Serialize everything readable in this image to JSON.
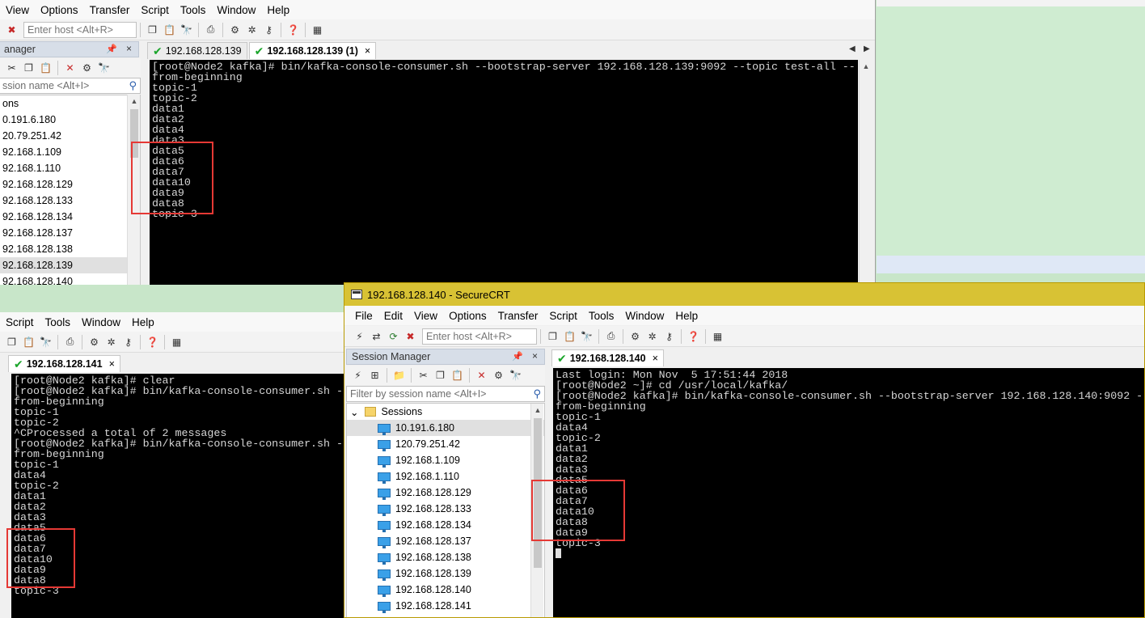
{
  "win_a": {
    "menu": [
      "View",
      "Options",
      "Transfer",
      "Script",
      "Tools",
      "Window",
      "Help"
    ],
    "host_placeholder": "Enter host <Alt+R>",
    "sm_title": "anager",
    "filter_placeholder": "ssion name <Alt+I>",
    "tree_header": "ons",
    "sessions": [
      "0.191.6.180",
      "20.79.251.42",
      "92.168.1.109",
      "92.168.1.110",
      "92.168.128.129",
      "92.168.128.133",
      "92.168.128.134",
      "92.168.128.137",
      "92.168.128.138",
      "92.168.128.139",
      "92.168.128.140"
    ],
    "selected_session": "92.168.128.139",
    "tabs": [
      {
        "label": "192.168.128.139",
        "active": false
      },
      {
        "label": "192.168.128.139 (1)",
        "active": true,
        "close": "×"
      }
    ],
    "terminal": [
      "[root@Node2 kafka]# bin/kafka-console-consumer.sh --bootstrap-server 192.168.128.139:9092 --topic test-all --",
      "from-beginning",
      "topic-1",
      "topic-2",
      "data1",
      "data2",
      "data4",
      "data3",
      "data5",
      "data6",
      "data7",
      "data10",
      "data9",
      "data8",
      "topic-3"
    ]
  },
  "win_b": {
    "menu": [
      "Script",
      "Tools",
      "Window",
      "Help"
    ],
    "tabs": [
      {
        "label": "192.168.128.141",
        "active": true,
        "close": "×"
      }
    ],
    "terminal": [
      "[root@Node2 kafka]# clear",
      "[root@Node2 kafka]# bin/kafka-console-consumer.sh -",
      "from-beginning",
      "topic-1",
      "topic-2",
      "^CProcessed a total of 2 messages",
      "[root@Node2 kafka]# bin/kafka-console-consumer.sh -",
      "from-beginning",
      "topic-1",
      "data4",
      "topic-2",
      "data1",
      "data2",
      "data3",
      "data5",
      "data6",
      "data7",
      "data10",
      "data9",
      "data8",
      "topic-3"
    ]
  },
  "win_c": {
    "title": "192.168.128.140 - SecureCRT",
    "menu": [
      "File",
      "Edit",
      "View",
      "Options",
      "Transfer",
      "Script",
      "Tools",
      "Window",
      "Help"
    ],
    "host_placeholder": "Enter host <Alt+R>",
    "sm_title": "Session Manager",
    "filter_placeholder": "Filter by session name <Alt+I>",
    "tree_header": "Sessions",
    "sessions": [
      "10.191.6.180",
      "120.79.251.42",
      "192.168.1.109",
      "192.168.1.110",
      "192.168.128.129",
      "192.168.128.133",
      "192.168.128.134",
      "192.168.128.137",
      "192.168.128.138",
      "192.168.128.139",
      "192.168.128.140",
      "192.168.128.141"
    ],
    "selected_session": "10.191.6.180",
    "tabs": [
      {
        "label": "192.168.128.140",
        "active": true,
        "close": "×"
      }
    ],
    "terminal": [
      "Last login: Mon Nov  5 17:51:44 2018",
      "[root@Node2 ~]# cd /usr/local/kafka/",
      "[root@Node2 kafka]# bin/kafka-console-consumer.sh --bootstrap-server 192.168.128.140:9092 -",
      "from-beginning",
      "topic-1",
      "data4",
      "topic-2",
      "data1",
      "data2",
      "data3",
      "data5",
      "data6",
      "data7",
      "data10",
      "data8",
      "data9",
      "topic-3"
    ]
  },
  "colors": {
    "titlebar_active": "#d8c234",
    "terminal_bg": "#000000",
    "terminal_fg": "#d6d6d6",
    "highlight_box": "#e53935",
    "tab_check": "#1aa52a"
  },
  "icons": [
    "disconnect-icon",
    "copy-icon",
    "paste-icon",
    "find-icon",
    "print-icon",
    "options-icon",
    "keymap-icon",
    "key-icon",
    "help-icon",
    "sftp-icon",
    "cut-icon",
    "delete-icon",
    "properties-icon",
    "search-icon",
    "checkmark-icon",
    "folder-icon",
    "monitor-icon"
  ]
}
